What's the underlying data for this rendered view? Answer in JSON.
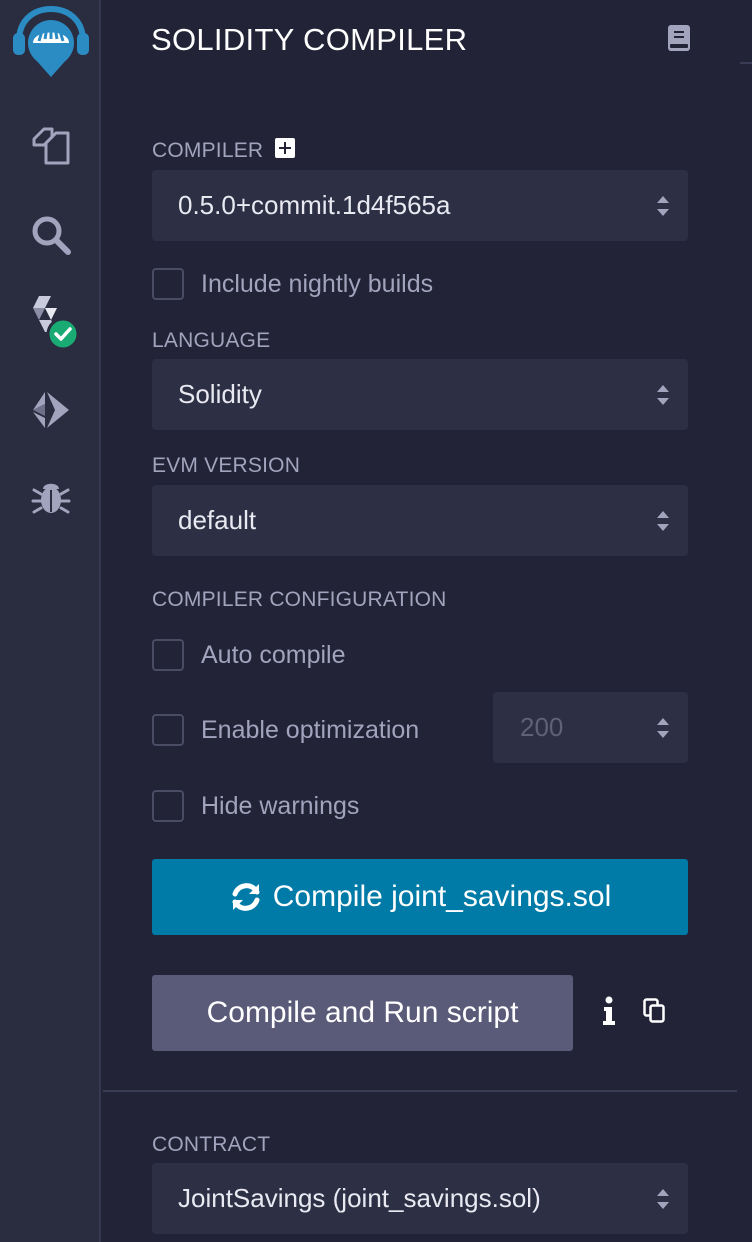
{
  "rail": {
    "items": [
      {
        "icon": "remix-logo-icon"
      },
      {
        "icon": "file-explorer-icon"
      },
      {
        "icon": "search-icon"
      },
      {
        "icon": "solidity-compiler-icon",
        "status": "compiled-success"
      },
      {
        "icon": "deploy-run-icon"
      },
      {
        "icon": "debugger-icon"
      }
    ]
  },
  "panel": {
    "title": "SOLIDITY COMPILER",
    "compiler_label": "COMPILER",
    "compiler_value": "0.5.0+commit.1d4f565a",
    "nightly_label": "Include nightly builds",
    "language_label": "LANGUAGE",
    "language_value": "Solidity",
    "evm_label": "EVM VERSION",
    "evm_value": "default",
    "config_label": "COMPILER CONFIGURATION",
    "auto_compile_label": "Auto compile",
    "optimization_label": "Enable optimization",
    "optimization_runs": "200",
    "hide_warnings_label": "Hide warnings",
    "compile_button": "Compile joint_savings.sol",
    "run_script_button": "Compile and Run script",
    "contract_label": "CONTRACT",
    "contract_value": "JointSavings (joint_savings.sol)"
  },
  "colors": {
    "background": "#222336",
    "rail": "#2a2c3f",
    "accent": "#007aa6",
    "secondary_button": "#595b79",
    "success": "#1aaa74",
    "logo": "#2b8cc4"
  }
}
